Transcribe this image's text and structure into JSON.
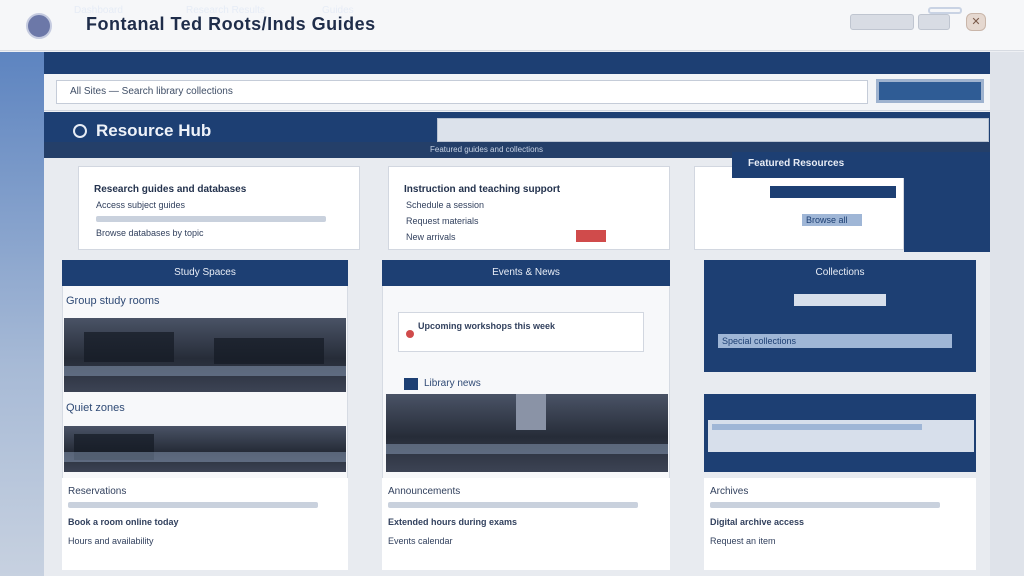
{
  "window": {
    "title": "Fontanal Ted Roots/Inds Guides",
    "logo_icon": "app-logo-icon"
  },
  "nav": {
    "items": [
      "Dashboard",
      "Research Results",
      "Guides"
    ],
    "menu_icon": "hamburger-icon"
  },
  "toolbar": {
    "address_text": "All Sites   —   Search library collections"
  },
  "header": {
    "title": "Resource Hub",
    "subtitle": "Featured guides and collections"
  },
  "top_cards": [
    {
      "title": "Research guides and databases",
      "lines": [
        "Access subject guides",
        "Browse databases by topic"
      ]
    },
    {
      "title": "Instruction and teaching support",
      "lines": [
        "Schedule a session",
        "Request materials",
        "New arrivals"
      ]
    },
    {
      "title": "Featured Resources",
      "lines": [
        "Browse all"
      ]
    }
  ],
  "columns": [
    {
      "header": "Study Spaces",
      "section_1": "Group study rooms",
      "section_2": "Quiet zones",
      "footer_title": "Reservations",
      "footer_items": [
        "Book a room online today",
        "Hours and availability"
      ]
    },
    {
      "header": "Events & News",
      "section_1": "Upcoming workshops this week",
      "section_2": "Library news",
      "footer_title": "Announcements",
      "footer_items": [
        "Extended hours during exams",
        "Events calendar"
      ]
    },
    {
      "header": "Collections",
      "section_1": "Special collections",
      "section_2": "",
      "footer_title": "Archives",
      "footer_items": [
        "Digital archive access",
        "Request an item"
      ]
    }
  ],
  "colors": {
    "primary": "#1d3f73",
    "accent": "#9fb6d6",
    "background": "#e8ebf0",
    "alert": "#d04b4b"
  }
}
